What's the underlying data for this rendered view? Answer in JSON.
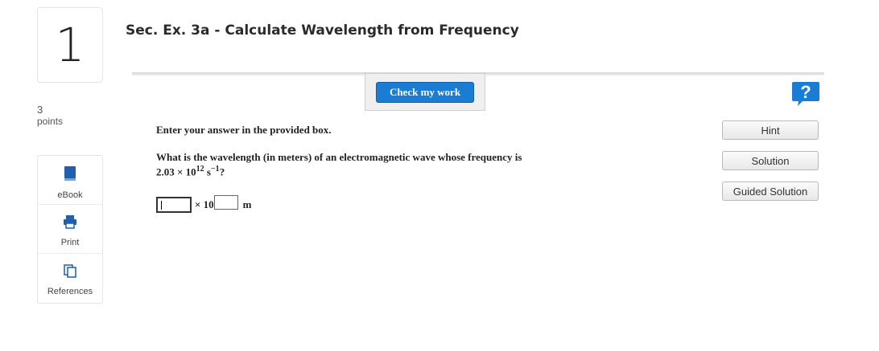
{
  "question": {
    "number": "1",
    "title": "Sec. Ex. 3a - Calculate Wavelength from Frequency",
    "points_value": "3",
    "points_label": "points"
  },
  "sidebar": {
    "items": [
      {
        "label": "eBook",
        "icon": "book-icon"
      },
      {
        "label": "Print",
        "icon": "printer-icon"
      },
      {
        "label": "References",
        "icon": "references-icon"
      }
    ]
  },
  "toolbar": {
    "check_label": "Check my work",
    "help_symbol": "?"
  },
  "body": {
    "instruction": "Enter your answer in the provided box.",
    "question_line1": "What is the wavelength (in meters) of an electromagnetic wave whose frequency is",
    "freq_mantissa": "2.03 × 10",
    "freq_exponent": "12",
    "freq_unit": " s",
    "freq_unit_exponent": "−1",
    "freq_end": "?"
  },
  "answer": {
    "mantissa_value": "",
    "times_ten": "× 10",
    "exponent_value": "",
    "unit": "m"
  },
  "buttons": {
    "hint": "Hint",
    "solution": "Solution",
    "guided_solution": "Guided Solution"
  },
  "colors": {
    "accent": "#1b7cd4",
    "help_bg": "#1b7cd4"
  }
}
